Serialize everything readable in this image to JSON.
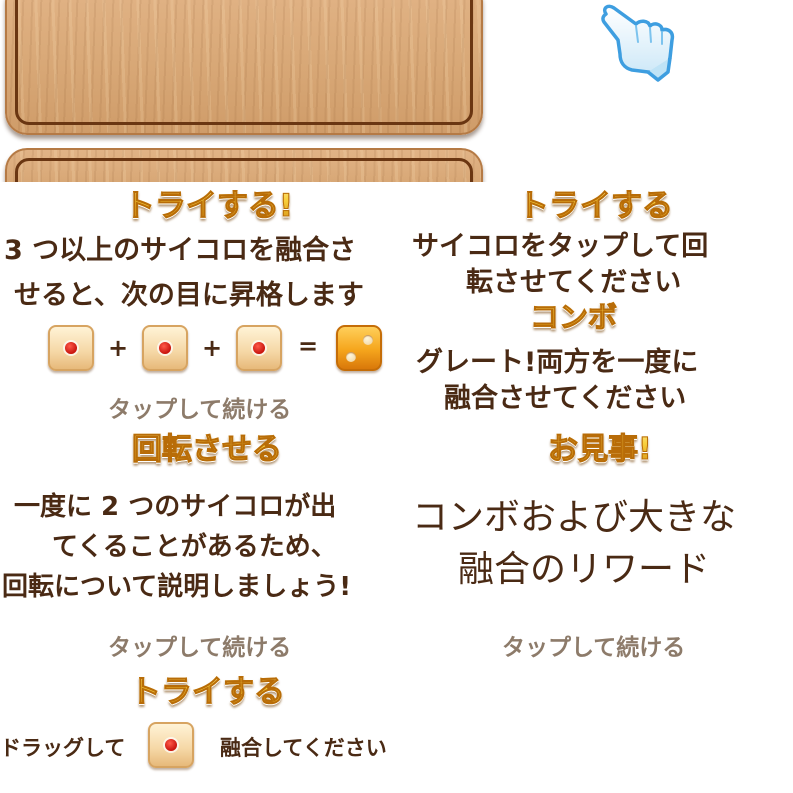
{
  "tutorial_try_title": "トライする!",
  "tutorial_try_body": [
    "3 つ以上のサイコロを融合さ",
    "せると、次の目に昇格します"
  ],
  "equation_ops": [
    "+",
    "+",
    "="
  ],
  "tap_continue_1": "タップして続ける",
  "tutorial_try_title_2": "トライする",
  "tutorial_try_body_2": [
    "サイコロをタップして回",
    "転させてください"
  ],
  "combo_title": "コンボ",
  "combo_body": [
    "グレート!両方を一度に",
    "融合させてください"
  ],
  "rotate_title": "回転させる",
  "rotate_body": [
    "一度に 2 つのサイコロが出",
    "てくることがあるため、",
    "回転について説明しましょう!"
  ],
  "tap_continue_2": "タップして続ける",
  "nice_title": "お見事!",
  "nice_body": [
    "コンボおよび大きな",
    "融合のリワード"
  ],
  "tap_continue_3": "タップして続ける",
  "drag_title": "トライする",
  "drag_left": "ドラッグして",
  "drag_right": "融合してください",
  "icons": [
    "wood-board",
    "pointing-hand-icon",
    "die-one-icon",
    "die-two-gold-icon"
  ]
}
